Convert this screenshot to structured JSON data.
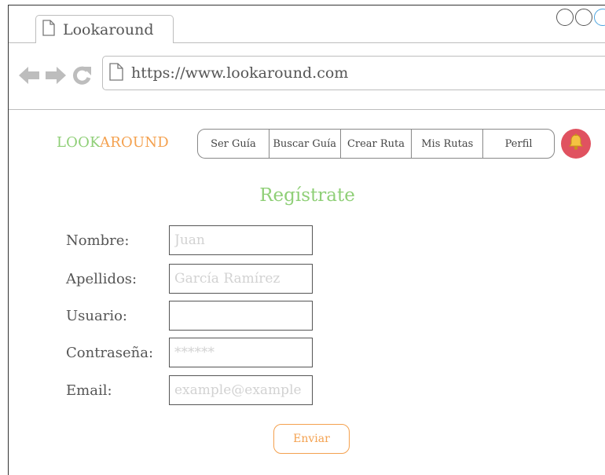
{
  "browser": {
    "tab_title": "Lookaround",
    "url": "https://www.lookaround.com",
    "icons": {
      "back": "back-arrow-icon",
      "forward": "forward-arrow-icon",
      "reload": "reload-icon",
      "page": "page-icon"
    }
  },
  "header": {
    "brand_part1": "LOOK",
    "brand_part2": "AROUND",
    "nav": {
      "ser_guia": "Ser Guía",
      "buscar_guia": "Buscar Guía",
      "crear_ruta": "Crear Ruta",
      "mis_rutas": "Mis Rutas",
      "perfil": "Perfil"
    },
    "notification_icon": "bell-icon"
  },
  "form": {
    "title": "Regístrate",
    "nombre": {
      "label": "Nombre:",
      "value": "",
      "placeholder": "Juan"
    },
    "apellidos": {
      "label": "Apellidos:",
      "value": "",
      "placeholder": "García Ramírez"
    },
    "usuario": {
      "label": "Usuario:",
      "value": "",
      "placeholder": ""
    },
    "contrasena": {
      "label": "Contraseña:",
      "value": "",
      "placeholder": "******"
    },
    "email": {
      "label": "Email:",
      "value": "",
      "placeholder": "example@example"
    },
    "submit_label": "Enviar"
  },
  "colors": {
    "brand_green": "#8fcf77",
    "brand_orange": "#f4a14f",
    "bell_red": "#e05260"
  }
}
